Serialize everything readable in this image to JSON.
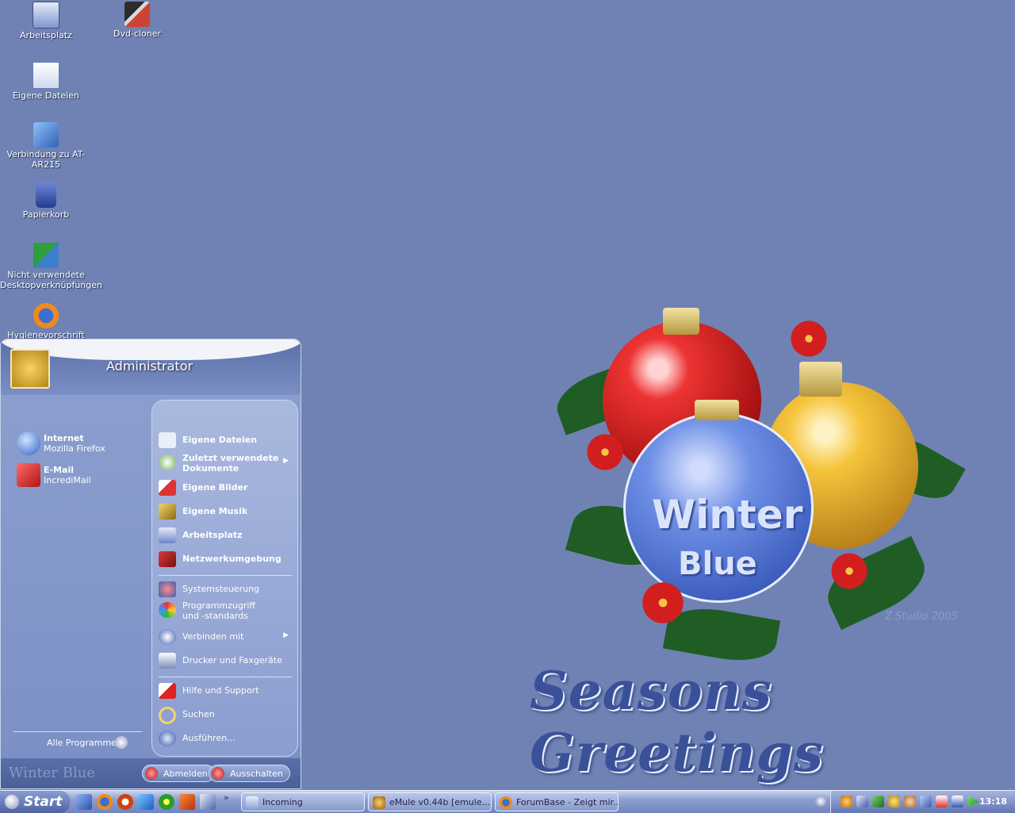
{
  "desktop": {
    "icons": [
      {
        "label": "Arbeitsplatz",
        "icon": "computer-icon"
      },
      {
        "label": "Dvd-cloner",
        "icon": "clapperboard-icon"
      },
      {
        "label": "Eigene Dateien",
        "icon": "documents-folder-icon"
      },
      {
        "label": "Verbindung zu AT-AR215",
        "icon": "network-connection-icon"
      },
      {
        "label": "Papierkorb",
        "icon": "recycle-bin-icon"
      },
      {
        "label": "Nicht verwendete Desktopverknüpfungen",
        "icon": "unused-shortcuts-icon"
      },
      {
        "label": "Hygienevorschrift",
        "icon": "firefox-icon"
      }
    ],
    "wallpaper": {
      "ball_line1": "Winter",
      "ball_line2": "Blue",
      "greeting": "Seasons Greetings",
      "credit": "Z Studio 2005"
    }
  },
  "start_menu": {
    "user_name": "Administrator",
    "pinned": [
      {
        "title": "Internet",
        "subtitle": "Mozilla Firefox"
      },
      {
        "title": "E-Mail",
        "subtitle": "IncrediMail"
      }
    ],
    "all_programs": "Alle Programme",
    "right_items": [
      {
        "label": "Eigene Dateien",
        "bold": true
      },
      {
        "label": "Zuletzt verwendete Dokumente",
        "bold": true,
        "submenu": true
      },
      {
        "label": "Eigene Bilder",
        "bold": true
      },
      {
        "label": "Eigene Musik",
        "bold": true
      },
      {
        "label": "Arbeitsplatz",
        "bold": true
      },
      {
        "label": "Netzwerkumgebung",
        "bold": true
      },
      {
        "label": "Systemsteuerung"
      },
      {
        "label": "Programmzugriff und -standards"
      },
      {
        "label": "Verbinden mit",
        "submenu": true
      },
      {
        "label": "Drucker und Faxgeräte"
      },
      {
        "label": "Hilfe und Support"
      },
      {
        "label": "Suchen"
      },
      {
        "label": "Ausführen..."
      }
    ],
    "logoff": "Abmelden",
    "shutdown": "Ausschalten",
    "theme_watermark": "Winter Blue"
  },
  "taskbar": {
    "start_label": "Start",
    "overflow": "»",
    "tasks": [
      {
        "label": "Incoming"
      },
      {
        "label": "eMule v0.44b [emule...."
      },
      {
        "label": "ForumBase - Zeigt mir..."
      }
    ],
    "clock": "13:18"
  },
  "colors": {
    "desktop_bg": "#6f82b3",
    "menu_bg": "#7b8fc4",
    "greeting_blue": "#3a5199"
  }
}
